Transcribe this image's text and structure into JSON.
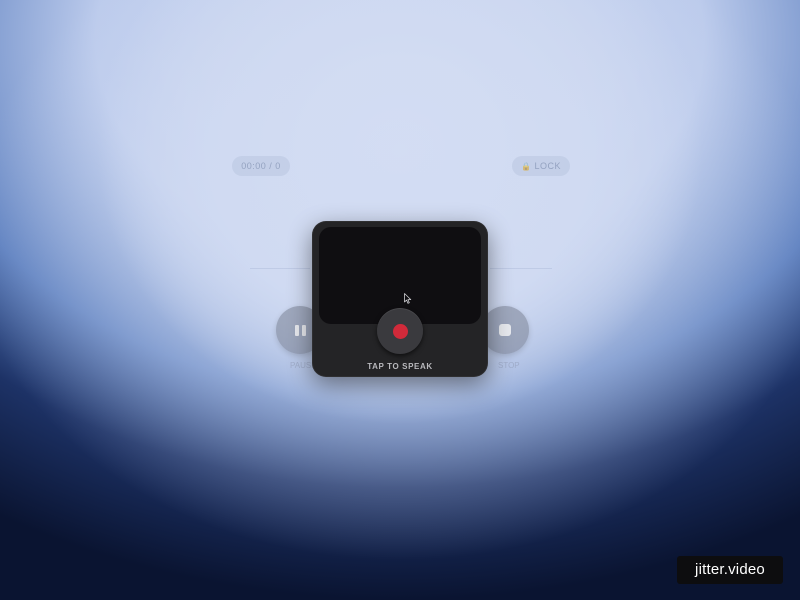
{
  "status_bar": {
    "time_pill": "00:00 / 0",
    "lock_label": "LOCK",
    "lock_icon": "lock-icon"
  },
  "controls": {
    "pause_icon": "pause-icon",
    "pause_label": "PAUSE",
    "stop_icon": "stop-icon",
    "stop_label": "STOP"
  },
  "recorder": {
    "record_icon": "record-dot-icon",
    "record_color": "#d12a3a",
    "speak_label": "TAP TO SPEAK"
  },
  "watermark": {
    "text": "jitter.video"
  }
}
